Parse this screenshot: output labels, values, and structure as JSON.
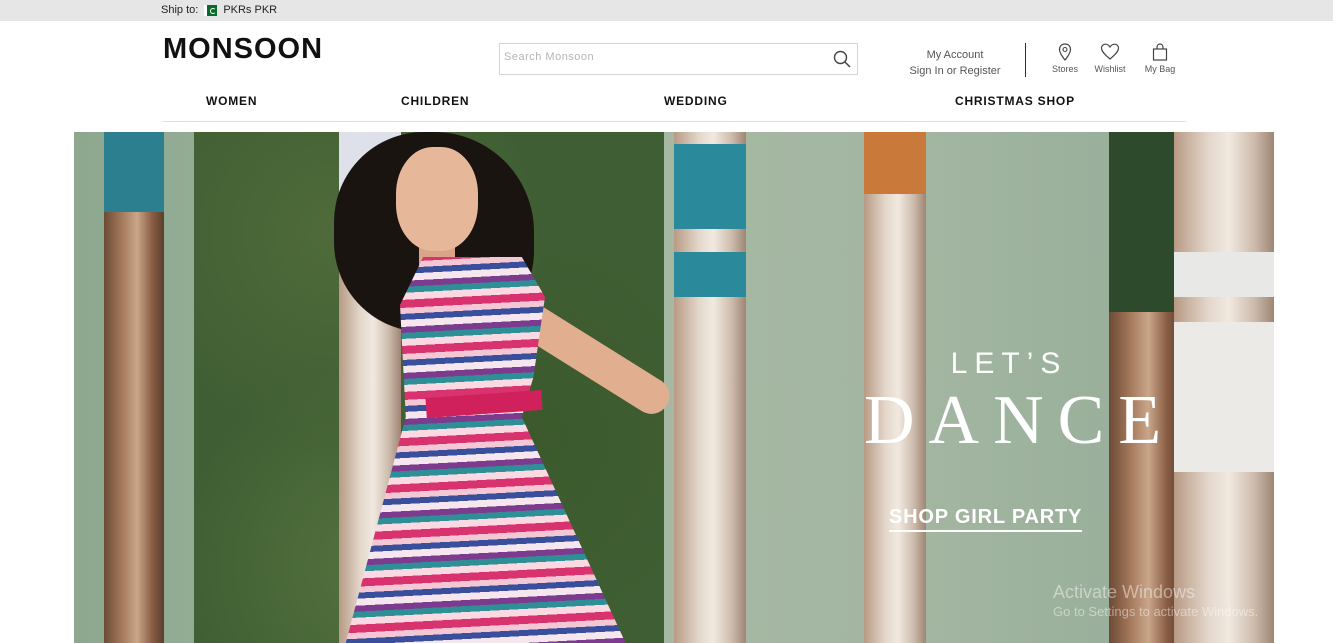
{
  "topbar": {
    "ship_label": "Ship to:",
    "currency": "PKRs PKR"
  },
  "header": {
    "logo": "MONSOON",
    "search": {
      "placeholder": "Search Monsoon",
      "value": ""
    },
    "account": {
      "title": "My Account",
      "sign_in": "Sign In or Register"
    },
    "utilities": {
      "stores": "Stores",
      "wishlist": "Wishlist",
      "bag": "My Bag"
    }
  },
  "nav": {
    "items": [
      "WOMEN",
      "CHILDREN",
      "WEDDING",
      "CHRISTMAS SHOP"
    ]
  },
  "hero": {
    "line1": "LET’S",
    "line2": "DANCE",
    "cta": "SHOP GIRL PARTY"
  },
  "watermark": {
    "title": "Activate Windows",
    "subtitle": "Go to Settings to activate Windows."
  },
  "colors": {
    "topbar": "#e6e6e6",
    "hero_background": "#a3b6a1",
    "text": "#111111"
  }
}
